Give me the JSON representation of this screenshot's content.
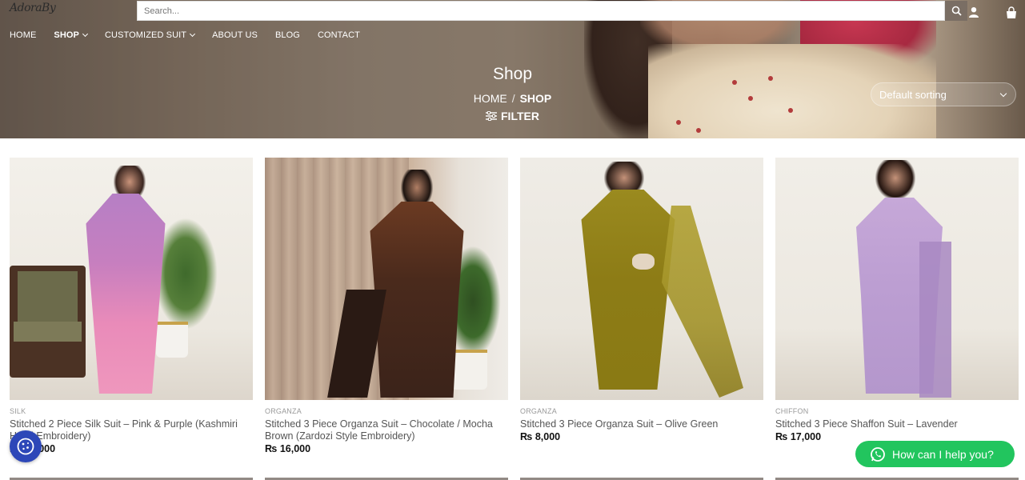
{
  "header": {
    "logo_text": "AdoraBy",
    "search_placeholder": "Search...",
    "nav": [
      {
        "label": "HOME",
        "bold": false,
        "dropdown": false
      },
      {
        "label": "SHOP",
        "bold": true,
        "dropdown": true
      },
      {
        "label": "CUSTOMIZED SUIT",
        "bold": false,
        "dropdown": true
      },
      {
        "label": "ABOUT US",
        "bold": false,
        "dropdown": false
      },
      {
        "label": "BLOG",
        "bold": false,
        "dropdown": false
      },
      {
        "label": "CONTACT",
        "bold": false,
        "dropdown": false
      }
    ]
  },
  "hero": {
    "title": "Shop",
    "breadcrumb_home": "HOME",
    "breadcrumb_sep": "/",
    "breadcrumb_current": "SHOP",
    "filter_label": "FILTER",
    "sorting_selected": "Default sorting"
  },
  "products": [
    {
      "category": "SILK",
      "title": "Stitched 2 Piece Silk Suit – Pink & Purple (Kashmiri Hand Embroidery)",
      "currency": "₨",
      "price": "12,000"
    },
    {
      "category": "ORGANZA",
      "title": "Stitched 3 Piece Organza Suit – Chocolate / Mocha Brown (Zardozi Style Embroidery)",
      "currency": "₨",
      "price": "16,000"
    },
    {
      "category": "ORGANZA",
      "title": "Stitched 3 Piece Organza Suit – Olive Green",
      "currency": "₨",
      "price": "8,000"
    },
    {
      "category": "CHIFFON",
      "title": "Stitched 3 Piece Shaffon Suit – Lavender",
      "currency": "₨",
      "price": "17,000"
    }
  ],
  "whatsapp": {
    "label": "How can I help you?"
  },
  "colors": {
    "accent_green": "#22c55e",
    "cookie_blue": "#2d47b8",
    "search_button": "#7a6e64"
  },
  "icons": [
    "search-icon",
    "user-icon",
    "cart-icon",
    "filter-icon",
    "whatsapp-icon",
    "cookie-icon"
  ]
}
